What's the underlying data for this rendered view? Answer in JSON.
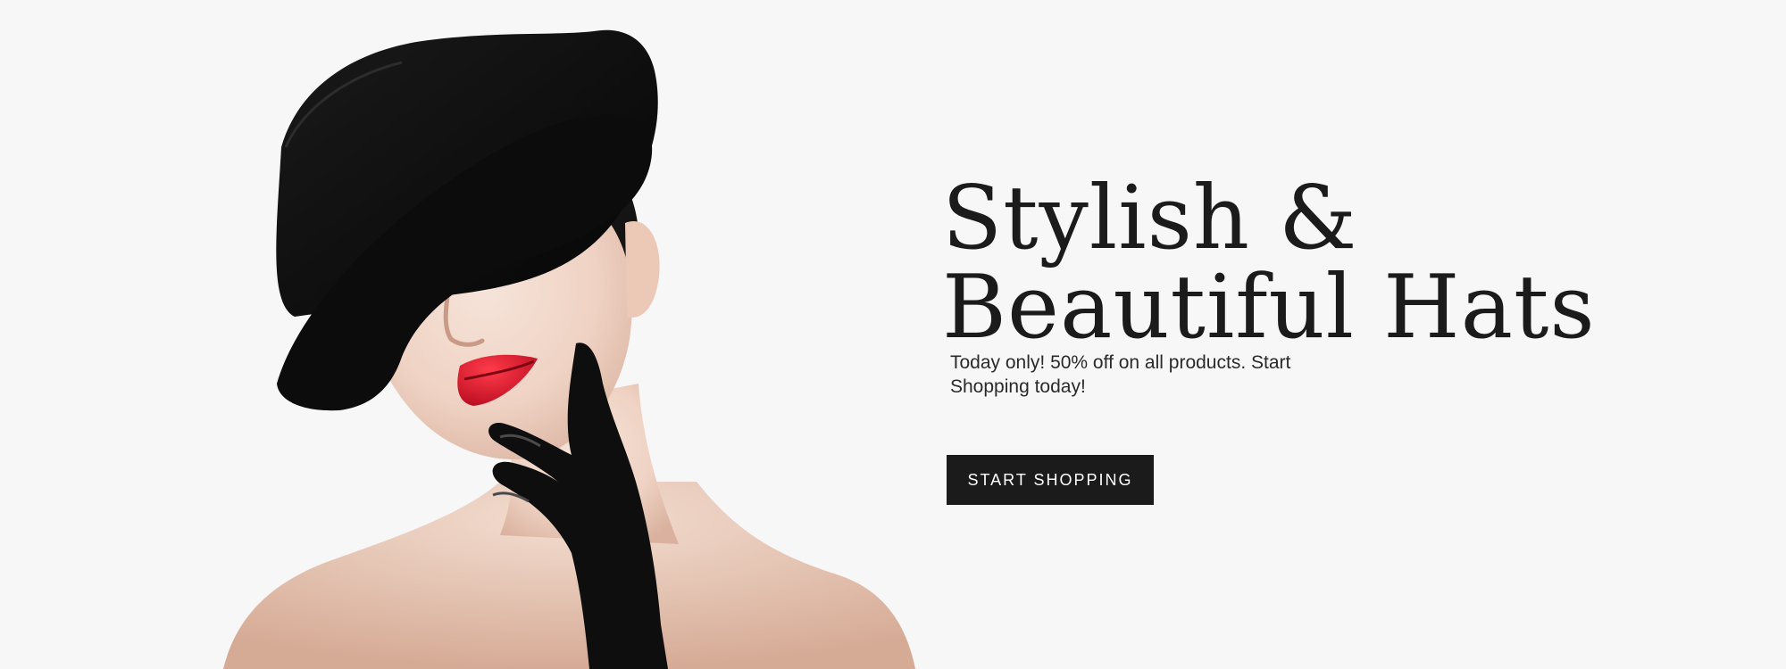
{
  "hero": {
    "headline_line1": "Stylish &",
    "headline_line2": "Beautiful Hats",
    "subtext": "Today only! 50% off on  all products. Start Shopping today!",
    "cta_label": "START SHOPPING"
  },
  "colors": {
    "background": "#f7f7f7",
    "text_dark": "#1b1b1b",
    "button_bg": "#1b1b1b",
    "button_text": "#ffffff",
    "lip_red": "#d4152a"
  }
}
